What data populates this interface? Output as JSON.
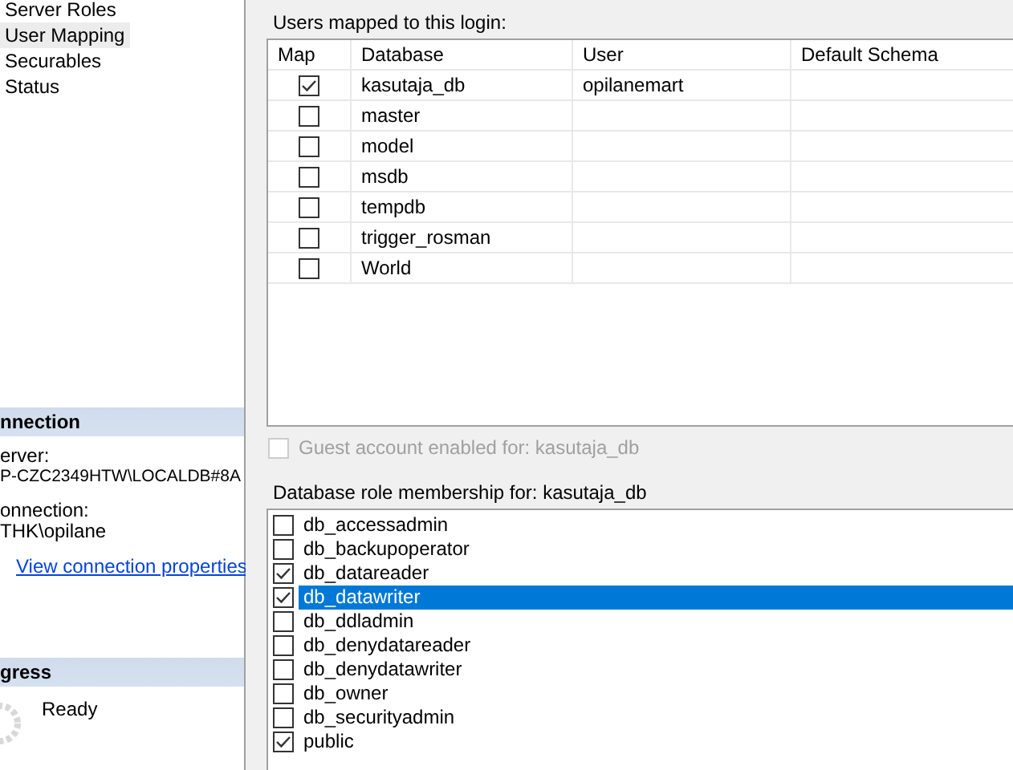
{
  "sidebar": {
    "pages": [
      {
        "label": "Server Roles",
        "selected": false
      },
      {
        "label": "User Mapping",
        "selected": true
      },
      {
        "label": "Securables",
        "selected": false
      },
      {
        "label": "Status",
        "selected": false
      }
    ],
    "connection": {
      "header": "nnection",
      "server_label": "erver:",
      "server": "P-CZC2349HTW\\LOCALDB#8A",
      "connection_label": "onnection:",
      "connection": "THK\\opilane",
      "link": "View connection properties"
    },
    "progress": {
      "header": "gress",
      "status": "Ready"
    }
  },
  "users_mapping": {
    "label": "Users mapped to this login:",
    "columns": [
      "Map",
      "Database",
      "User",
      "Default Schema"
    ],
    "rows": [
      {
        "checked": true,
        "database": "kasutaja_db",
        "user": "opilanemart"
      },
      {
        "checked": false,
        "database": "master"
      },
      {
        "checked": false,
        "database": "model"
      },
      {
        "checked": false,
        "database": "msdb"
      },
      {
        "checked": false,
        "database": "tempdb"
      },
      {
        "checked": false,
        "database": "trigger_rosman"
      },
      {
        "checked": false,
        "database": "World"
      }
    ]
  },
  "guest": {
    "label": "Guest account enabled for: kasutaja_db",
    "checked": false,
    "disabled": true
  },
  "roles": {
    "label": "Database role membership for: kasutaja_db",
    "items": [
      {
        "label": "db_accessadmin",
        "checked": false,
        "selected": false
      },
      {
        "label": "db_backupoperator",
        "checked": false,
        "selected": false
      },
      {
        "label": "db_datareader",
        "checked": true,
        "selected": false
      },
      {
        "label": "db_datawriter",
        "checked": true,
        "selected": true
      },
      {
        "label": "db_ddladmin",
        "checked": false,
        "selected": false
      },
      {
        "label": "db_denydatareader",
        "checked": false,
        "selected": false
      },
      {
        "label": "db_denydatawriter",
        "checked": false,
        "selected": false
      },
      {
        "label": "db_owner",
        "checked": false,
        "selected": false
      },
      {
        "label": "db_securityadmin",
        "checked": false,
        "selected": false
      },
      {
        "label": "public",
        "checked": true,
        "selected": false
      }
    ]
  }
}
